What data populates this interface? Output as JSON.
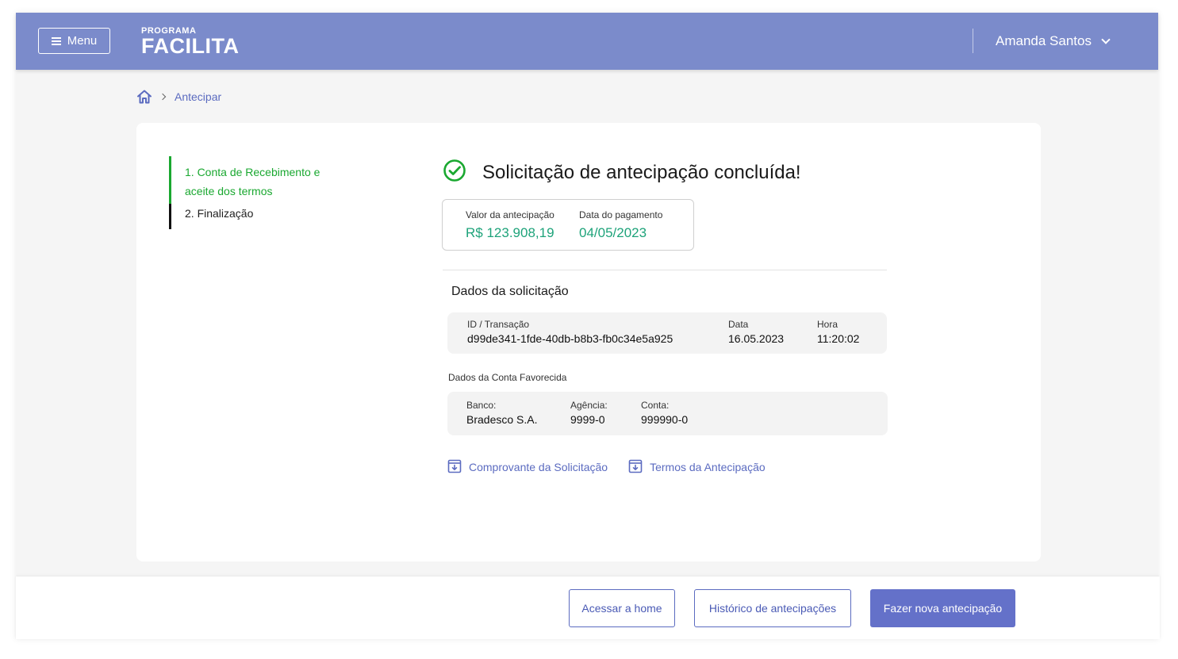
{
  "header": {
    "menu_label": "Menu",
    "logo_small": "PROGRAMA",
    "logo_big": "FACILITA",
    "user_name": "Amanda Santos"
  },
  "breadcrumb": {
    "current": "Antecipar"
  },
  "stepper": {
    "steps": [
      {
        "label": "1. Conta de Recebimento e aceite dos termos",
        "state": "done"
      },
      {
        "label": "2. Finalização",
        "state": "current"
      }
    ]
  },
  "success": {
    "title": "Solicitação de antecipação concluída!"
  },
  "summary": {
    "amount_label": "Valor da antecipação",
    "amount_value": "R$ 123.908,19",
    "date_label": "Data do pagamento",
    "date_value": "04/05/2023"
  },
  "request": {
    "section_title": "Dados da solicitação",
    "id_label": "ID / Transação",
    "id_value": "d99de341-1fde-40db-b8b3-fb0c34e5a925",
    "date_label": "Data",
    "date_value": "16.05.2023",
    "time_label": "Hora",
    "time_value": "11:20:02"
  },
  "account": {
    "section_title": "Dados da Conta Favorecida",
    "bank_label": "Banco:",
    "bank_value": "Bradesco S.A.",
    "agency_label": "Agência:",
    "agency_value": "9999-0",
    "account_label": "Conta:",
    "account_value": "999990-0"
  },
  "documents": {
    "receipt_label": "Comprovante da Solicitação",
    "terms_label": "Termos da Antecipação"
  },
  "footer": {
    "home_button": "Acessar a home",
    "history_button": "Histórico de antecipações",
    "new_button": "Fazer nova antecipação"
  },
  "colors": {
    "header_bg": "#7b8bcb",
    "accent": "#5b6bc0",
    "primary_button": "#6471c9",
    "success_green": "#1aa830",
    "value_green": "#1ea37a"
  },
  "icons": {
    "menu": "hamburger-icon",
    "user": "chevron-down-icon",
    "home": "home-icon",
    "separator": "chevron-right-icon",
    "success": "check-circle-icon",
    "download": "download-box-icon"
  }
}
